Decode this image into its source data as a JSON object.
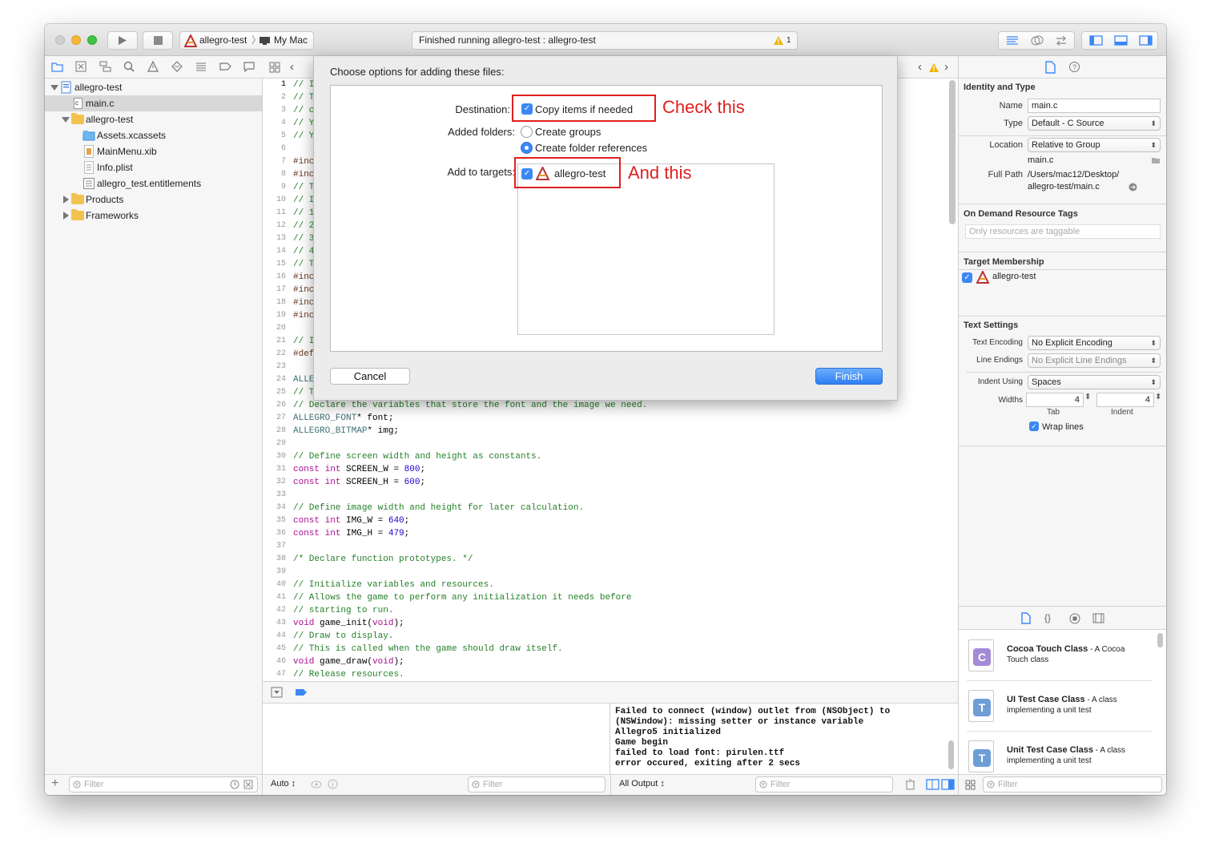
{
  "titlebar": {
    "scheme_target": "allegro-test",
    "scheme_device": "My Mac",
    "activity_status": "Finished running allegro-test : allegro-test",
    "warning_count": "1"
  },
  "navigator": {
    "project_name": "allegro-test",
    "items": [
      {
        "label": "main.c",
        "kind": "c-file"
      },
      {
        "label": "allegro-test",
        "kind": "folder"
      },
      {
        "label": "Assets.xcassets",
        "kind": "asset-catalog"
      },
      {
        "label": "MainMenu.xib",
        "kind": "xib"
      },
      {
        "label": "Info.plist",
        "kind": "plist"
      },
      {
        "label": "allegro_test.entitlements",
        "kind": "entitlements"
      },
      {
        "label": "Products",
        "kind": "folder"
      },
      {
        "label": "Frameworks",
        "kind": "folder"
      }
    ],
    "filter_placeholder": "Filter"
  },
  "editor": {
    "line_numbers": [
      "1",
      "2",
      "3",
      "4",
      "5",
      "6",
      "7",
      "8",
      "9",
      "10",
      "11",
      "12",
      "13",
      "14",
      "15",
      "16",
      "17",
      "18",
      "19",
      "20",
      "21",
      "22",
      "23",
      "24",
      "25",
      "26",
      "27",
      "28",
      "29",
      "30",
      "31",
      "32",
      "33",
      "34",
      "35",
      "36",
      "37",
      "38",
      "39",
      "40",
      "41",
      "42",
      "43",
      "44",
      "45",
      "46",
      "47"
    ],
    "partial_lines": {
      "l1": "// I",
      "l2": "// T",
      "l3": "// c",
      "l4": "// Y",
      "l5": "// Y",
      "l7": "#inc",
      "l8": "#inc",
      "l9": "// T",
      "l10": "// I",
      "l11": "// 1",
      "l12": "// 2",
      "l13": "// 3",
      "l14": "// 4",
      "l15": "// T",
      "l16": "#inc",
      "l17": "#inc",
      "l18": "#inc",
      "l19": "#inc",
      "l21": "// I",
      "l22": "#def",
      "l24": "ALLE",
      "l25": "// T"
    },
    "lines": {
      "l26": "// Declare the variables that store the font and the image we need.",
      "l27a": "ALLEGRO_FONT",
      "l27b": "* font;",
      "l28a": "ALLEGRO_BITMAP",
      "l28b": "* img;",
      "l30": "// Define screen width and height as constants.",
      "l31a": "const",
      "l31b": "int",
      "l31c": " SCREEN_W = ",
      "l31d": "800",
      "l31e": ";",
      "l32a": "const",
      "l32b": "int",
      "l32c": " SCREEN_H = ",
      "l32d": "600",
      "l32e": ";",
      "l34": "// Define image width and height for later calculation.",
      "l35a": "const",
      "l35b": "int",
      "l35c": " IMG_W = ",
      "l35d": "640",
      "l35e": ";",
      "l36a": "const",
      "l36b": "int",
      "l36c": " IMG_H = ",
      "l36d": "479",
      "l36e": ";",
      "l38": "/* Declare function prototypes. */",
      "l40": "// Initialize variables and resources.",
      "l41": "// Allows the game to perform any initialization it needs before",
      "l42": "// starting to run.",
      "l43a": "void",
      "l43b": " game_init(",
      "l43c": "void",
      "l43d": ");",
      "l44": "// Draw to display.",
      "l45": "// This is called when the game should draw itself.",
      "l46a": "void",
      "l46b": " game_draw(",
      "l46c": "void",
      "l46d": ");",
      "l47": "// Release resources."
    }
  },
  "debug": {
    "auto_label": "Auto ↕",
    "output_label": "All Output ↕",
    "filter_placeholder": "Filter",
    "console_lines": [
      "Failed to connect (window) outlet from (NSObject) to",
      "(NSWindow): missing setter or instance variable",
      "Allegro5 initialized",
      "Game begin",
      "failed to load font: pirulen.ttf",
      "error occured, exiting after 2 secs"
    ]
  },
  "sheet": {
    "heading": "Choose options for adding these files:",
    "destination_label": "Destination:",
    "copy_items_label": "Copy items if needed",
    "added_folders_label": "Added folders:",
    "create_groups_label": "Create groups",
    "create_folder_refs_label": "Create folder references",
    "add_to_targets_label": "Add to targets:",
    "target_name": "allegro-test",
    "cancel_label": "Cancel",
    "finish_label": "Finish",
    "annotation_1": "Check this",
    "annotation_2": "And this"
  },
  "inspector": {
    "identity_title": "Identity and Type",
    "name_label": "Name",
    "name_value": "main.c",
    "type_label": "Type",
    "type_value": "Default - C Source",
    "location_label": "Location",
    "location_value": "Relative to Group",
    "location_file": "main.c",
    "fullpath_label": "Full Path",
    "fullpath_line1": "/Users/mac12/Desktop/",
    "fullpath_line2": "allegro-test/main.c",
    "odr_title": "On Demand Resource Tags",
    "odr_placeholder": "Only resources are taggable",
    "target_title": "Target Membership",
    "target_name": "allegro-test",
    "text_settings_title": "Text Settings",
    "encoding_label": "Text Encoding",
    "encoding_value": "No Explicit Encoding",
    "line_endings_label": "Line Endings",
    "line_endings_value": "No Explicit Line Endings",
    "indent_using_label": "Indent Using",
    "indent_using_value": "Spaces",
    "widths_label": "Widths",
    "tab_value": "4",
    "indent_value": "4",
    "tab_label": "Tab",
    "indent_label": "Indent",
    "wrap_lines_label": "Wrap lines",
    "library": [
      {
        "title": "Cocoa Touch Class",
        "desc1": " - A Cocoa",
        "desc2": "Touch class",
        "glyph": "C"
      },
      {
        "title": "UI Test Case Class",
        "desc1": " - A class",
        "desc2": "implementing a unit test",
        "glyph": "T"
      },
      {
        "title": "Unit Test Case Class",
        "desc1": " - A class",
        "desc2": "implementing a unit test",
        "glyph": "T"
      }
    ],
    "filter_placeholder": "Filter"
  },
  "colors": {
    "accent": "#3b88f5",
    "annotation_red": "#e02020",
    "comment_green": "#26802a",
    "keyword_purple": "#aa0d91",
    "number_blue": "#1c00cf"
  }
}
